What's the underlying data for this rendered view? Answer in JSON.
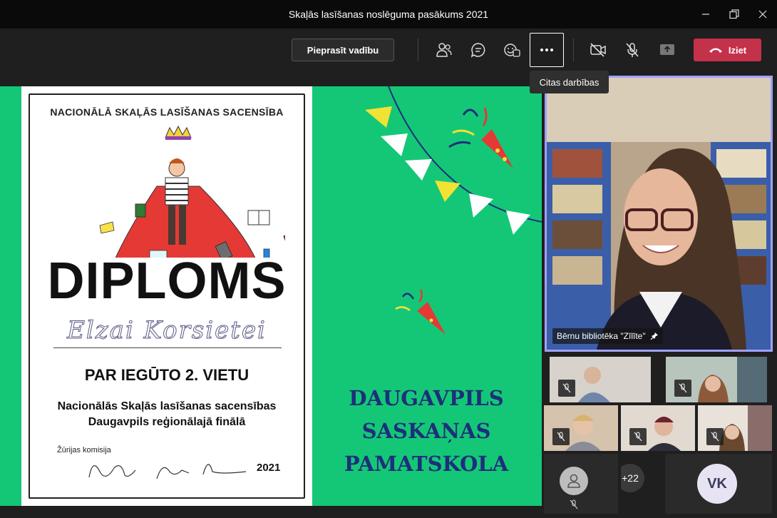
{
  "window": {
    "title": "Skaļās lasīšanas noslēguma pasākums 2021"
  },
  "toolbar": {
    "request_control_label": "Pieprasīt vadību",
    "leave_label": "Iziet",
    "more_tooltip": "Citas darbības",
    "icons": [
      "participants-icon",
      "chat-icon",
      "reactions-icon",
      "more-icon",
      "camera-off-icon",
      "mic-off-icon",
      "share-icon",
      "phone-hangup-icon"
    ]
  },
  "slide": {
    "competition": "NACIONĀLĀ SKAĻĀS LASĪŠANAS SACENSĪBA",
    "title": "DIPLOMS",
    "name": "Elzai Korsietei",
    "place": "PAR IEGŪTO 2. VIETU",
    "subtitle_line1": "Nacionālās Skaļās lasīšanas sacensības",
    "subtitle_line2": "Daugavpils reģionālajā finālā",
    "jury_label": "Žūrijas komisija",
    "year": "2021",
    "school_line1": "DAUGAVPILS",
    "school_line2": "SASKAŅAS",
    "school_line3": "PAMATSKOLA"
  },
  "participants": {
    "pinned_name": "Bērnu bibliotēka \"Zīlīte\"",
    "overflow_count": "+22",
    "initials": "VK"
  },
  "colors": {
    "slide_green": "#14c777",
    "leave_red": "#c4314b",
    "pinned_border": "#9ea2ff",
    "school_text": "#1d2f7a"
  }
}
